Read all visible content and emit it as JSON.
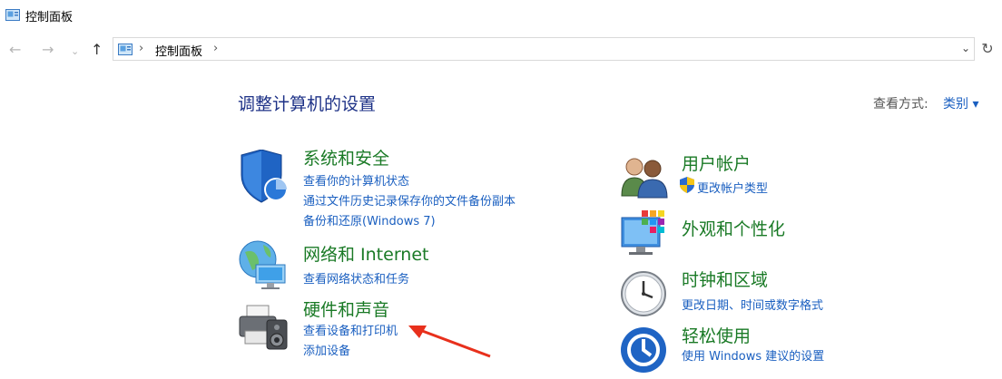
{
  "window": {
    "title": "控制面板",
    "icon": "control-panel-icon"
  },
  "nav": {
    "back_icon": "arrow-left-icon",
    "forward_icon": "arrow-right-icon",
    "recent_icon": "chevron-down-icon",
    "up_icon": "arrow-up-icon",
    "refresh_icon": "refresh-icon"
  },
  "address": {
    "breadcrumb": "控制面板",
    "separator": "›"
  },
  "main": {
    "heading": "调整计算机的设置",
    "view_by_label": "查看方式:",
    "view_by_value": "类别 ▾"
  },
  "categories": {
    "system": {
      "title": "系统和安全",
      "icon": "shield-icon",
      "links": [
        "查看你的计算机状态",
        "通过文件历史记录保存你的文件备份副本",
        "备份和还原(Windows 7)"
      ]
    },
    "network": {
      "title": "网络和 Internet",
      "icon": "globe-network-icon",
      "links": [
        "查看网络状态和任务"
      ]
    },
    "hardware": {
      "title": "硬件和声音",
      "icon": "printer-icon",
      "links": [
        "查看设备和打印机",
        "添加设备"
      ]
    },
    "user": {
      "title": "用户帐户",
      "icon": "users-icon",
      "links": [
        "更改帐户类型"
      ],
      "link_icon": "uac-shield-icon"
    },
    "appearance": {
      "title": "外观和个性化",
      "icon": "monitor-palette-icon",
      "links": []
    },
    "clock": {
      "title": "时钟和区域",
      "icon": "clock-icon",
      "links": [
        "更改日期、时间或数字格式"
      ]
    },
    "ease": {
      "title": "轻松使用",
      "icon": "ease-of-access-icon",
      "links": [
        "使用 Windows 建议的设置"
      ]
    }
  },
  "colors": {
    "heading": "#1e3287",
    "category_title": "#1a7a26",
    "link": "#1a5fc0",
    "annotation": "#e8301c"
  }
}
